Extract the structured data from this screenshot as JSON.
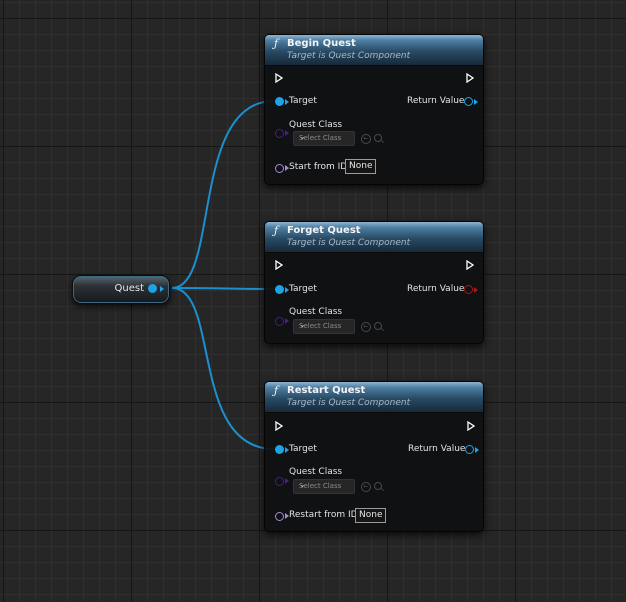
{
  "variable_node": {
    "label": "Quest"
  },
  "nodes": [
    {
      "title": "Begin Quest",
      "subtitle": "Target is Quest Component",
      "target_label": "Target",
      "return_label": "Return Value",
      "class_label": "Quest Class",
      "class_placeholder": "Select Class",
      "extra_label": "Start from ID",
      "extra_value": "None"
    },
    {
      "title": "Forget Quest",
      "subtitle": "Target is Quest Component",
      "target_label": "Target",
      "return_label": "Return Value",
      "class_label": "Quest Class",
      "class_placeholder": "Select Class"
    },
    {
      "title": "Restart Quest",
      "subtitle": "Target is Quest Component",
      "target_label": "Target",
      "return_label": "Return Value",
      "class_label": "Quest Class",
      "class_placeholder": "Select Class",
      "extra_label": "Restart from ID",
      "extra_value": "None"
    }
  ],
  "icons": {
    "function": "ƒ",
    "dropdown": "chevron-down-icon",
    "use": "arrow-left-circle-icon",
    "browse": "search-icon"
  },
  "colors": {
    "object_pin": "#1ea3e8",
    "class_pin": "#4a1d8a",
    "name_pin": "#a88ad6",
    "bool_return_pin": "#a51818",
    "wire": "#1b8fd0"
  }
}
